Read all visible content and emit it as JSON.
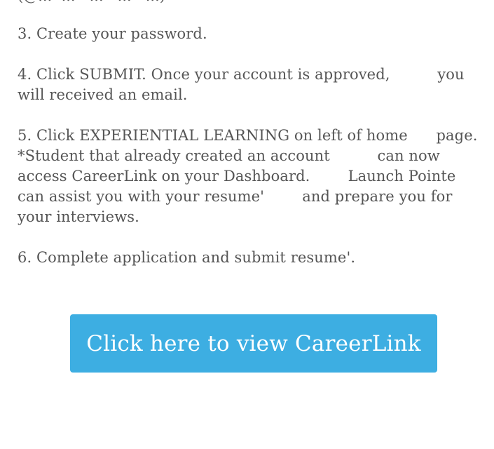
{
  "text": {
    "partial_top": "(@...  ...   ...   ...   ...)",
    "lines": [
      "3. Create your password.",
      "",
      "4. Click SUBMIT. Once your account is approved,          you",
      "will received an email.",
      "",
      "5. Click EXPERIENTIAL LEARNING on left of home      page.",
      "*Student that already created an account          can now",
      "access CareerLink on your Dashboard.        Launch Pointe",
      "can assist you with your resume'        and prepare you for",
      "your interviews.",
      "",
      "6. Complete application and submit resume'."
    ]
  },
  "cta": {
    "label": "Click here to view CareerLink",
    "color": "#3daee2"
  }
}
